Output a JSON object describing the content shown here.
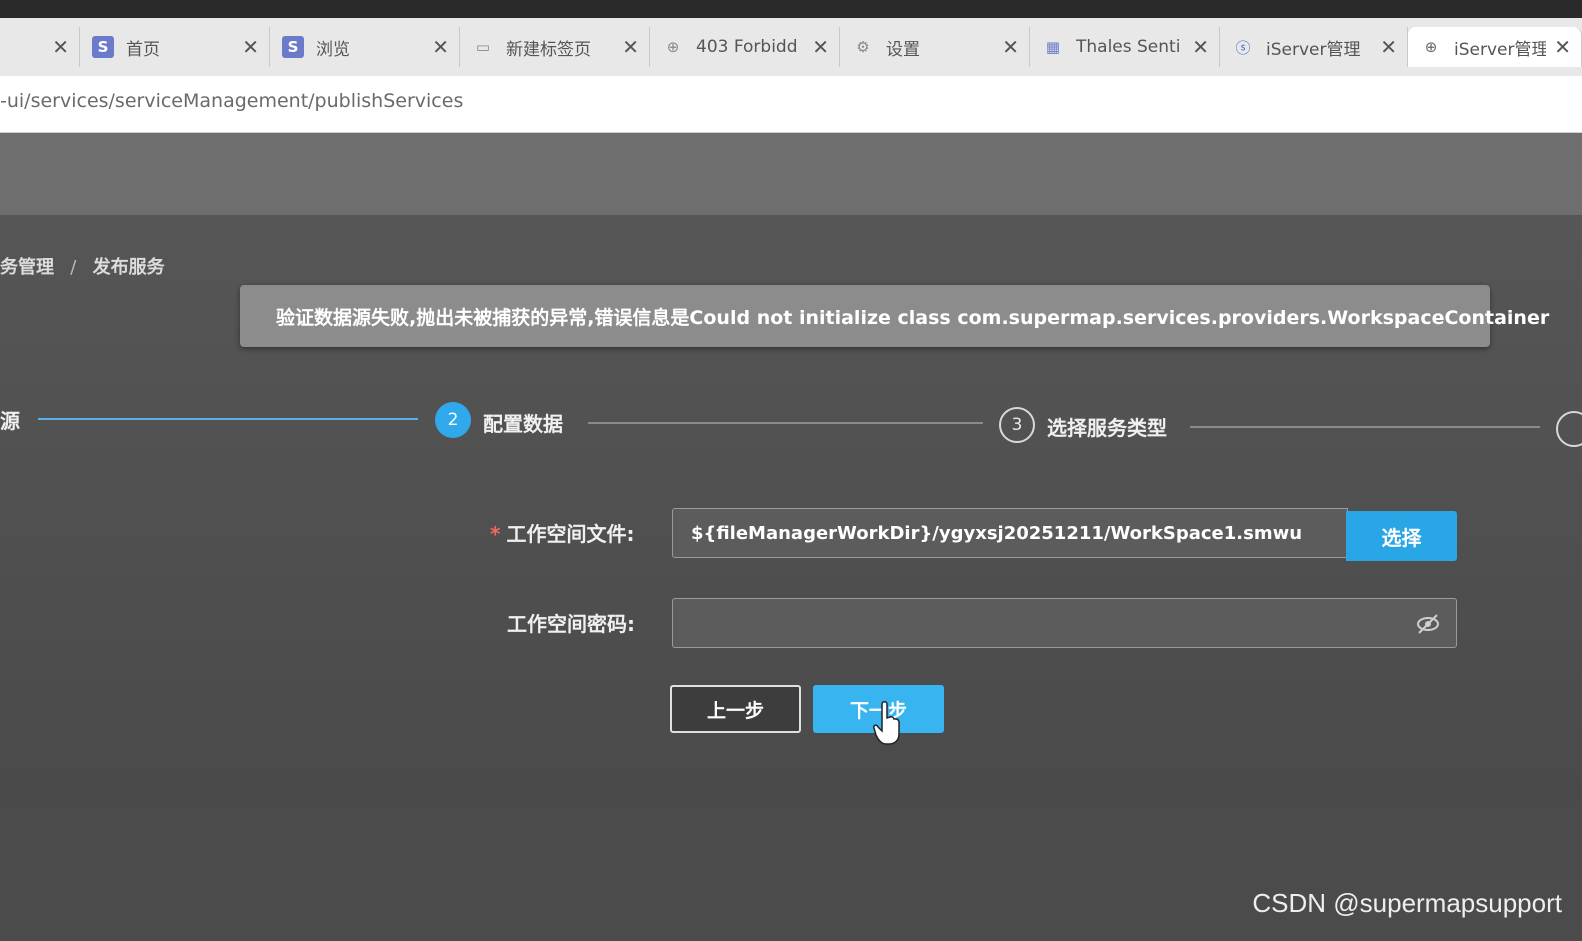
{
  "browser": {
    "tabs": [
      {
        "icon": "",
        "label": "",
        "close": "✕"
      },
      {
        "icon": "S",
        "label": "首页",
        "close": "✕"
      },
      {
        "icon": "S",
        "label": "浏览",
        "close": "✕"
      },
      {
        "icon": "▭",
        "label": "新建标签页",
        "close": "✕"
      },
      {
        "icon": "⊕",
        "label": "403 Forbidd",
        "close": "✕"
      },
      {
        "icon": "⚙",
        "label": "设置",
        "close": "✕"
      },
      {
        "icon": "▦",
        "label": "Thales Senti",
        "close": "✕"
      },
      {
        "icon": "ⓢ",
        "label": "iServer管理",
        "close": "✕"
      },
      {
        "icon": "⊕",
        "label": "iServer管理",
        "close": "✕"
      }
    ],
    "url": "-ui/services/serviceManagement/publishServices"
  },
  "breadcrumb": {
    "parent": "务管理",
    "separator": "/",
    "current": "发布服务"
  },
  "error": {
    "icon": "error-icon",
    "message": "验证数据源失败,抛出未被捕获的异常,错误信息是Could not initialize class com.supermap.services.providers.WorkspaceContainer",
    "color": "#ef6b5c"
  },
  "steps": [
    {
      "number": "",
      "label": "源",
      "status": "done"
    },
    {
      "number": "2",
      "label": "配置数据",
      "status": "active"
    },
    {
      "number": "3",
      "label": "选择服务类型",
      "status": "pending"
    }
  ],
  "form": {
    "workspace_file": {
      "required_mark": "*",
      "label": "工作空间文件:",
      "value": "${fileManagerWorkDir}/ygyxsj20251211/WorkSpace1.smwu",
      "select_label": "选择"
    },
    "workspace_password": {
      "label": "工作空间密码:",
      "value": ""
    }
  },
  "buttons": {
    "prev": "上一步",
    "next": "下一步"
  },
  "colors": {
    "accent": "#29a6e6",
    "error": "#ef6b5c"
  },
  "watermark": "CSDN @supermapsupport"
}
